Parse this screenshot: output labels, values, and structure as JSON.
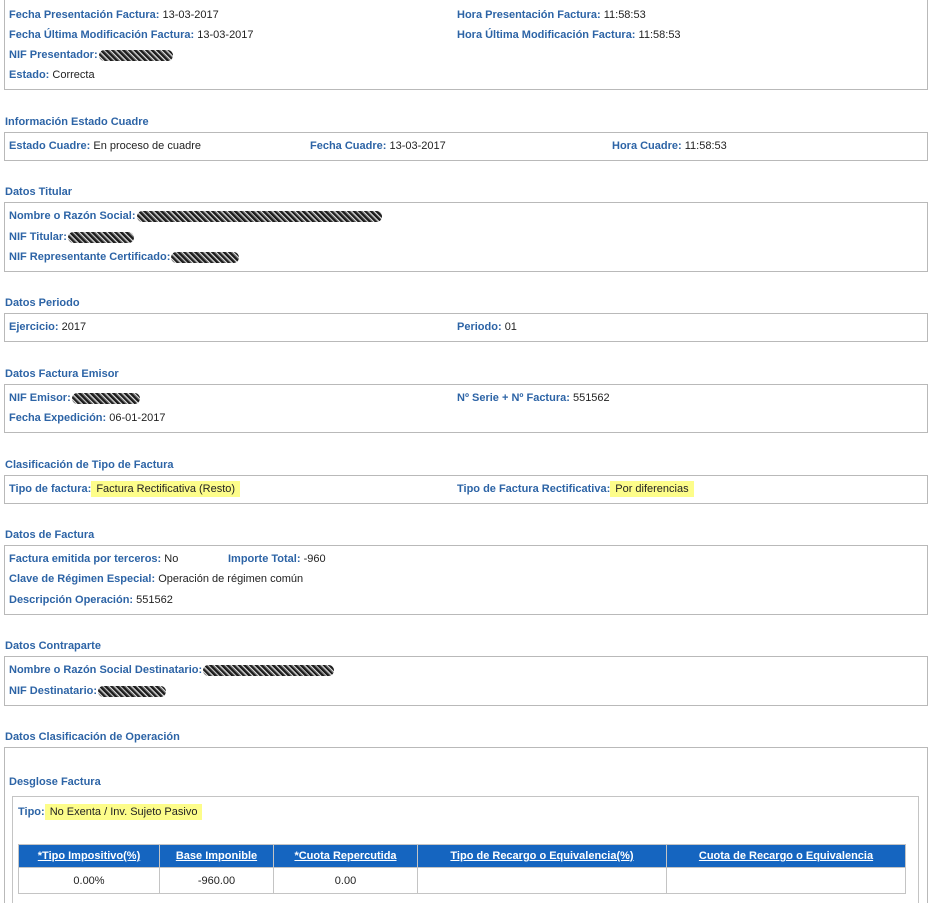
{
  "cabecera": {
    "fecha_presentacion_label": "Fecha Presentación Factura:",
    "fecha_presentacion": "13-03-2017",
    "hora_presentacion_label": "Hora Presentación Factura:",
    "hora_presentacion": "11:58:53",
    "fecha_modificacion_label": "Fecha Última Modificación Factura:",
    "fecha_modificacion": "13-03-2017",
    "hora_modificacion_label": "Hora Última Modificación Factura:",
    "hora_modificacion": "11:58:53",
    "nif_presentador_label": "NIF Presentador:",
    "estado_label": "Estado:",
    "estado": "Correcta"
  },
  "estado_cuadre": {
    "title": "Información Estado Cuadre",
    "estado_label": "Estado Cuadre:",
    "estado": "En proceso de cuadre",
    "fecha_label": "Fecha Cuadre:",
    "fecha": "13-03-2017",
    "hora_label": "Hora Cuadre:",
    "hora": "11:58:53"
  },
  "titular": {
    "title": "Datos Titular",
    "nombre_label": "Nombre o Razón Social:",
    "nif_label": "NIF Titular:",
    "nif_representante_label": "NIF Representante Certificado:"
  },
  "periodo": {
    "title": "Datos Periodo",
    "ejercicio_label": "Ejercicio:",
    "ejercicio": "2017",
    "periodo_label": "Periodo:",
    "periodo": "01"
  },
  "emisor": {
    "title": "Datos Factura Emisor",
    "nif_label": "NIF Emisor:",
    "serie_label": "Nº Serie + Nº Factura:",
    "serie": "551562",
    "fecha_label": "Fecha Expedición:",
    "fecha": "06-01-2017"
  },
  "clasificacion": {
    "title": "Clasificación de Tipo de Factura",
    "tipo_label": "Tipo de factura:",
    "tipo": "Factura Rectificativa (Resto)",
    "tipo_rect_label": "Tipo de Factura Rectificativa:",
    "tipo_rect": "Por diferencias"
  },
  "factura": {
    "title": "Datos de Factura",
    "terceros_label": "Factura emitida por terceros:",
    "terceros": "No",
    "importe_label": "Importe Total:",
    "importe": "-960",
    "clave_label": "Clave de Régimen Especial:",
    "clave": "Operación de régimen común",
    "descripcion_label": "Descripción Operación:",
    "descripcion": "551562"
  },
  "contraparte": {
    "title": "Datos Contraparte",
    "nombre_label": "Nombre o Razón Social Destinatario:",
    "nif_label": "NIF Destinatario:"
  },
  "operacion": {
    "title": "Datos Clasificación de Operación",
    "desglose_title": "Desglose Factura",
    "tipo_label": "Tipo:",
    "tipo": "No Exenta / Inv. Sujeto Pasivo",
    "table": {
      "headers": [
        "*Tipo Impositivo(%)",
        "Base Imponible",
        "*Cuota Repercutida",
        "Tipo de Recargo o Equivalencia(%)",
        "Cuota de Recargo o Equivalencia"
      ],
      "rows": [
        [
          "0.00%",
          "-960.00",
          "0.00",
          "",
          ""
        ]
      ]
    }
  },
  "colors": {
    "label": "#2d64a6",
    "table_header": "#1565c0",
    "highlight": "#fdfd8a",
    "border": "#b9b9b9"
  }
}
